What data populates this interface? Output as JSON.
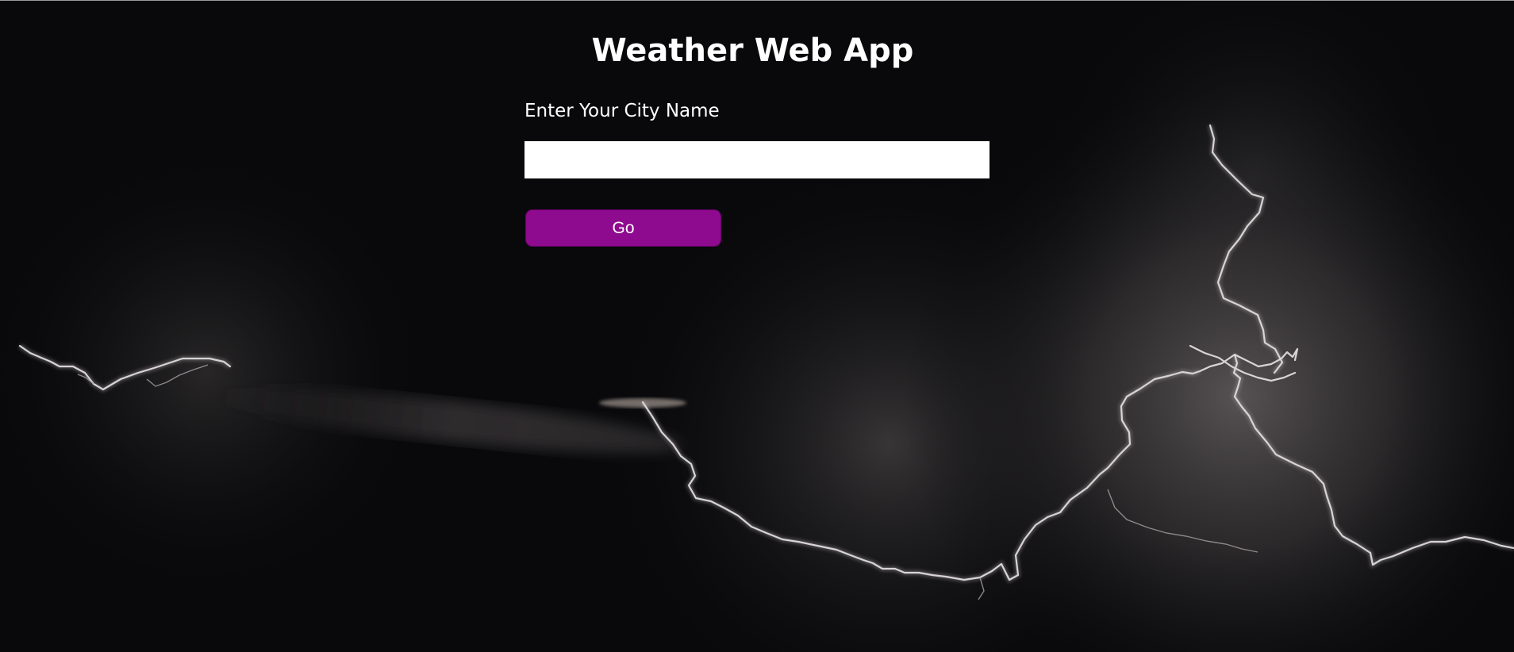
{
  "header": {
    "title": "Weather Web App"
  },
  "form": {
    "city_label": "Enter Your City Name",
    "city_value": "",
    "city_placeholder": "",
    "submit_label": "Go"
  },
  "colors": {
    "page_background": "#09090b",
    "button_background": "#8e0a8e",
    "text": "#ffffff",
    "input_background": "#ffffff"
  },
  "background": {
    "subject": "lightning-storm-night-sky"
  }
}
